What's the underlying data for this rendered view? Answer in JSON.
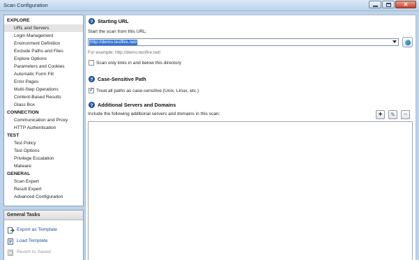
{
  "window": {
    "title": "Scan Configuration",
    "buttons": [
      "minimize",
      "maximize",
      "close"
    ]
  },
  "sidebar": {
    "categories": [
      {
        "label": "EXPLORE",
        "items": [
          "URL and Servers",
          "Login Management",
          "Environment Definition",
          "Exclude Paths and Files",
          "Explore Options",
          "Parameters and Cookies",
          "Automatic Form Fill",
          "Error Pages",
          "Multi-Step Operations",
          "Content-Based Results",
          "Glass Box"
        ]
      },
      {
        "label": "CONNECTION",
        "items": [
          "Communication and Proxy",
          "HTTP Authentication"
        ]
      },
      {
        "label": "TEST",
        "items": [
          "Test Policy",
          "Test Options",
          "Privilege Escalation",
          "Malware"
        ]
      },
      {
        "label": "GENERAL",
        "items": [
          "Scan Expert",
          "Result Expert",
          "Advanced Configuration"
        ]
      }
    ],
    "selected_item": "URL and Servers"
  },
  "general_tasks": {
    "header": "General Tasks",
    "items": [
      {
        "label": "Export as Template",
        "enabled": true,
        "icon": "export-icon"
      },
      {
        "label": "Load Template",
        "enabled": true,
        "icon": "load-icon"
      },
      {
        "label": "Revert to Saved",
        "enabled": false,
        "icon": "revert-icon"
      }
    ]
  },
  "starting_url": {
    "title": "Starting URL",
    "prompt": "Start the scan from this URL:",
    "value": "http://demo.testfire.net/",
    "example": "For example: http://demo.testfire.net/",
    "scan_only_below_label": "Scan only links in and below this directory",
    "scan_only_below_checked": false
  },
  "case_sensitive": {
    "title": "Case-Sensitive Path",
    "label": "Treat all paths as case-sensitive (Unix, Linux, etc.)",
    "checked": true
  },
  "additional_servers": {
    "title": "Additional Servers and Domains",
    "prompt": "Include the following additional servers and domains in this scan:",
    "entries": [],
    "toolbar": [
      {
        "name": "add",
        "glyph": "+",
        "enabled": true
      },
      {
        "name": "edit",
        "glyph": "✎",
        "enabled": false
      },
      {
        "name": "remove",
        "glyph": "−",
        "enabled": false
      }
    ]
  },
  "colors": {
    "selection_highlight": "#3375d6",
    "link_text": "#1f4ea8",
    "section_icon": "#2c5fa8",
    "window_frame": "#bcd3ea"
  }
}
